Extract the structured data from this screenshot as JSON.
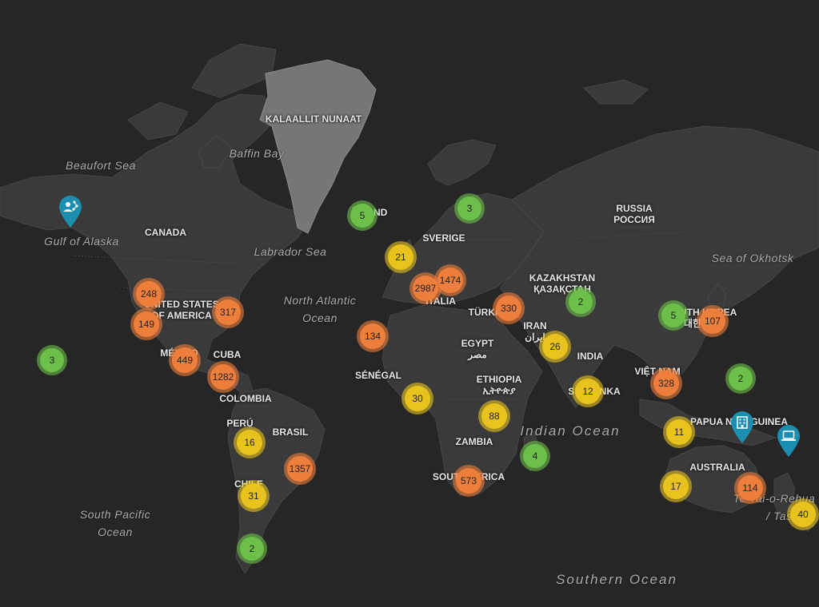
{
  "colors": {
    "background": "#262626",
    "land": "#3a3a3a",
    "greenland": "#767676",
    "small": "#6cc04a",
    "medium": "#e8c31e",
    "large": "#ee7e3b",
    "pin": "#1c8fb0"
  },
  "country_labels": [
    {
      "id": "greenland",
      "text": "KALAALLIT NUNAAT"
    },
    {
      "id": "iceland",
      "text": "ÍSLAND"
    },
    {
      "id": "canada",
      "text": "CANADA"
    },
    {
      "id": "usa",
      "text": "UNITED STATES\nOF AMERICA"
    },
    {
      "id": "mexico",
      "text": "MÉXICO"
    },
    {
      "id": "cuba",
      "text": "CUBA"
    },
    {
      "id": "colombia",
      "text": "COLOMBIA"
    },
    {
      "id": "peru",
      "text": "PERÚ"
    },
    {
      "id": "brasil",
      "text": "BRASIL"
    },
    {
      "id": "chile",
      "text": "CHILE"
    },
    {
      "id": "sverige",
      "text": "SVERIGE"
    },
    {
      "id": "italia",
      "text": "ITALIA"
    },
    {
      "id": "turkiye",
      "text": "TÜRKİYE"
    },
    {
      "id": "russia",
      "text": "RUSSIA\nРОССИЯ"
    },
    {
      "id": "kazakhstan",
      "text": "KAZAKHSTAN\nҚАЗАҚСТАН"
    },
    {
      "id": "iran",
      "text": "IRAN\nایران"
    },
    {
      "id": "egypt",
      "text": "EGYPT\nمصر"
    },
    {
      "id": "ethiopia",
      "text": "ETHIOPIA\nኢትዮጵያ"
    },
    {
      "id": "senegal",
      "text": "SÉNÉGAL"
    },
    {
      "id": "zambia",
      "text": "ZAMBIA"
    },
    {
      "id": "southafrica",
      "text": "SOUTH AFRICA"
    },
    {
      "id": "india",
      "text": "INDIA"
    },
    {
      "id": "srilanka",
      "text": "SRI LANKA"
    },
    {
      "id": "vietnam",
      "text": "VIỆT NAM"
    },
    {
      "id": "southkorea",
      "text": "SOUTH KOREA\n대한민국"
    },
    {
      "id": "png",
      "text": "PAPUA NEW GUINEA"
    },
    {
      "id": "australia",
      "text": "AUSTRALIA"
    }
  ],
  "water_labels": [
    {
      "id": "beaufort",
      "text": "Beaufort Sea"
    },
    {
      "id": "baffin",
      "text": "Baffin Bay"
    },
    {
      "id": "alaska",
      "text": "Gulf of Alaska"
    },
    {
      "id": "labrador",
      "text": "Labrador Sea"
    },
    {
      "id": "northatlantic",
      "text": "North Atlantic\nOcean"
    },
    {
      "id": "okhotsk",
      "text": "Sea of Okhotsk"
    },
    {
      "id": "indian",
      "text": "Indian Ocean"
    },
    {
      "id": "southpacific",
      "text": "South Pacific\nOcean"
    },
    {
      "id": "southern",
      "text": "Southern Ocean"
    },
    {
      "id": "tasman",
      "text": "Te Tai-o-Rehua\n/ Tasman"
    }
  ],
  "clusters": [
    {
      "id": "iceland",
      "count": "5",
      "level": "small"
    },
    {
      "id": "scandinavia",
      "count": "3",
      "level": "small"
    },
    {
      "id": "hawaii",
      "count": "3",
      "level": "small"
    },
    {
      "id": "kazakhstan",
      "count": "2",
      "level": "small"
    },
    {
      "id": "china",
      "count": "5",
      "level": "small"
    },
    {
      "id": "pacific-islands",
      "count": "2",
      "level": "small"
    },
    {
      "id": "madagascar",
      "count": "4",
      "level": "small"
    },
    {
      "id": "patagonia",
      "count": "2",
      "level": "small"
    },
    {
      "id": "ireland",
      "count": "21",
      "level": "medium"
    },
    {
      "id": "uae",
      "count": "26",
      "level": "medium"
    },
    {
      "id": "sri-lanka",
      "count": "12",
      "level": "medium"
    },
    {
      "id": "nigeria",
      "count": "30",
      "level": "medium"
    },
    {
      "id": "kenya",
      "count": "88",
      "level": "medium"
    },
    {
      "id": "peru",
      "count": "16",
      "level": "medium"
    },
    {
      "id": "chile",
      "count": "31",
      "level": "medium"
    },
    {
      "id": "indonesia",
      "count": "11",
      "level": "medium"
    },
    {
      "id": "west-australia",
      "count": "17",
      "level": "medium"
    },
    {
      "id": "new-zealand",
      "count": "40",
      "level": "medium"
    },
    {
      "id": "europe-west",
      "count": "2987",
      "level": "large"
    },
    {
      "id": "europe-central",
      "count": "1474",
      "level": "large"
    },
    {
      "id": "turkiye",
      "count": "330",
      "level": "large"
    },
    {
      "id": "west-africa",
      "count": "134",
      "level": "large"
    },
    {
      "id": "us-west-north",
      "count": "248",
      "level": "large"
    },
    {
      "id": "us-west-south",
      "count": "149",
      "level": "large"
    },
    {
      "id": "us-east",
      "count": "317",
      "level": "large"
    },
    {
      "id": "mexico",
      "count": "449",
      "level": "large"
    },
    {
      "id": "caribbean",
      "count": "1282",
      "level": "large"
    },
    {
      "id": "brazil",
      "count": "1357",
      "level": "large"
    },
    {
      "id": "south-africa",
      "count": "573",
      "level": "large"
    },
    {
      "id": "vietnam",
      "count": "328",
      "level": "large"
    },
    {
      "id": "japan",
      "count": "107",
      "level": "large"
    },
    {
      "id": "east-australia",
      "count": "114",
      "level": "large"
    }
  ],
  "pins": [
    {
      "id": "alaska",
      "icon": "person-network-icon"
    },
    {
      "id": "png",
      "icon": "building-icon"
    },
    {
      "id": "pacific",
      "icon": "laptop-icon"
    }
  ]
}
